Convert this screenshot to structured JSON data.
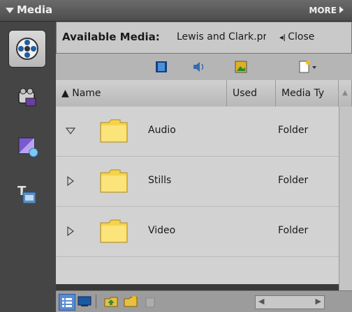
{
  "panel": {
    "title": "Media",
    "more_label": "MORE"
  },
  "header": {
    "label": "Available Media:",
    "file": "Lewis and Clark.pre",
    "close_label": "Close"
  },
  "columns": {
    "name": "Name",
    "used": "Used",
    "media_type": "Media Ty"
  },
  "rows": [
    {
      "name": "Audio",
      "type": "Folder",
      "expanded": true
    },
    {
      "name": "Stills",
      "type": "Folder",
      "expanded": false
    },
    {
      "name": "Video",
      "type": "Folder",
      "expanded": false
    }
  ],
  "sidebar": {
    "items": [
      "film-reel-icon",
      "video-camera-icon",
      "effects-icon",
      "titles-icon"
    ]
  },
  "toolbar": {
    "icons": [
      "video-filter-icon",
      "audio-filter-icon",
      "still-filter-icon",
      "new-item-icon"
    ]
  },
  "bottombar": {
    "icons": [
      "list-view-icon",
      "icon-view-icon",
      "folder-up-icon",
      "new-folder-icon",
      "trash-icon"
    ]
  },
  "colors": {
    "panel_bg": "#3e3e3e",
    "header_bg": "#c9c9c9",
    "list_bg": "#d2d2d2",
    "folder_yellow": "#f5d44a"
  }
}
